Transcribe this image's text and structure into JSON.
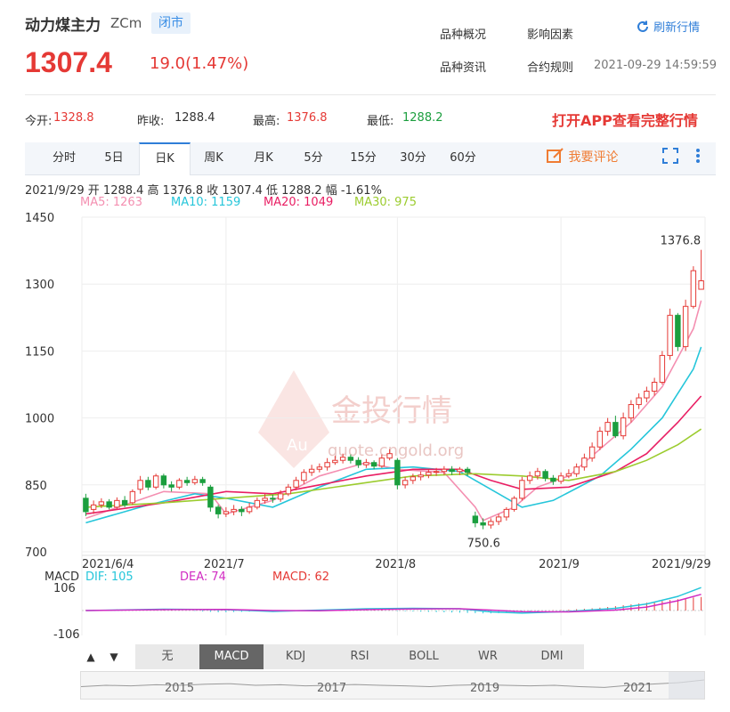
{
  "header": {
    "name": "动力煤主力",
    "code": "ZCm",
    "status": "闭市",
    "price": "1307.4",
    "change": "19.0(1.47%)",
    "links": [
      "品种概况",
      "影响因素",
      "品种资讯",
      "合约规则"
    ],
    "refresh_label": "刷新行情",
    "datetime": "2021-09-29 14:59:59"
  },
  "stats": {
    "open_label": "今开:",
    "open": "1328.8",
    "prev_label": "昨收:",
    "prev": "1288.4",
    "high_label": "最高:",
    "high": "1376.8",
    "low_label": "最低:",
    "low": "1288.2",
    "open_app": "打开APP查看完整行情"
  },
  "tabs": [
    "分时",
    "5日",
    "日K",
    "周K",
    "月K",
    "5分",
    "15分",
    "30分",
    "60分"
  ],
  "active_tab": "日K",
  "comment_label": "我要评论",
  "ohlc_line": "2021/9/29  开 1288.4  高 1376.8  收 1307.4  低 1288.2  幅 -1.61%",
  "ma_labels": [
    {
      "text": "MA5: 1263",
      "color": "#f48fb1"
    },
    {
      "text": "MA10: 1159",
      "color": "#26c6da"
    },
    {
      "text": "MA20: 1049",
      "color": "#e91e63"
    },
    {
      "text": "MA30: 975",
      "color": "#9ccc2f"
    }
  ],
  "watermark": {
    "text": "金投行情",
    "sub": "quote.cngold.org",
    "logo": "Au"
  },
  "macd_header": {
    "label": "MACD",
    "dif": "DIF: 105",
    "dea": "DEA: 74",
    "macd": "MACD: 62"
  },
  "macd_buttons": [
    "无",
    "MACD",
    "KDJ",
    "RSI",
    "BOLL",
    "WR",
    "DMI"
  ],
  "macd_active": "MACD",
  "arrows": [
    "▲",
    "▼"
  ],
  "navigator_years": [
    "2015",
    "2017",
    "2019",
    "2021"
  ],
  "colors": {
    "up": "#e53935",
    "down": "#1b9e3e",
    "accent": "#2f7ed8",
    "orange": "#f07c33"
  },
  "chart_data": {
    "type": "candlestick",
    "ylim": [
      700,
      1450
    ],
    "yticks": [
      1450,
      1300,
      1150,
      1000,
      850,
      700
    ],
    "xticks": [
      "2021/6/4",
      "2021/7",
      "2021/8",
      "2021/9",
      "2021/9/29"
    ],
    "annotations": [
      {
        "text": "1376.8",
        "value": 1376.8
      },
      {
        "text": "750.6",
        "value": 750.6
      }
    ],
    "candles": [
      [
        820,
        790,
        830,
        780
      ],
      [
        795,
        805,
        815,
        785
      ],
      [
        805,
        812,
        820,
        798
      ],
      [
        812,
        800,
        818,
        795
      ],
      [
        800,
        815,
        822,
        796
      ],
      [
        815,
        805,
        825,
        800
      ],
      [
        810,
        835,
        840,
        805
      ],
      [
        840,
        860,
        870,
        830
      ],
      [
        860,
        845,
        868,
        838
      ],
      [
        845,
        870,
        875,
        840
      ],
      [
        870,
        850,
        875,
        842
      ],
      [
        850,
        845,
        858,
        835
      ],
      [
        845,
        860,
        865,
        840
      ],
      [
        860,
        855,
        868,
        848
      ],
      [
        855,
        862,
        870,
        850
      ],
      [
        862,
        855,
        868,
        848
      ],
      [
        845,
        800,
        850,
        790
      ],
      [
        800,
        785,
        805,
        775
      ],
      [
        785,
        790,
        800,
        778
      ],
      [
        790,
        795,
        805,
        782
      ],
      [
        795,
        790,
        802,
        780
      ],
      [
        790,
        800,
        810,
        785
      ],
      [
        800,
        815,
        822,
        795
      ],
      [
        815,
        820,
        830,
        808
      ],
      [
        820,
        818,
        828,
        810
      ],
      [
        818,
        830,
        838,
        812
      ],
      [
        830,
        845,
        852,
        825
      ],
      [
        845,
        860,
        868,
        838
      ],
      [
        860,
        878,
        885,
        852
      ],
      [
        878,
        885,
        895,
        870
      ],
      [
        885,
        890,
        898,
        878
      ],
      [
        890,
        900,
        910,
        882
      ],
      [
        900,
        905,
        915,
        895
      ],
      [
        905,
        912,
        920,
        898
      ],
      [
        912,
        905,
        918,
        898
      ],
      [
        905,
        895,
        912,
        888
      ],
      [
        895,
        900,
        908,
        888
      ],
      [
        900,
        892,
        905,
        885
      ],
      [
        892,
        910,
        918,
        888
      ],
      [
        910,
        920,
        930,
        905
      ],
      [
        905,
        850,
        910,
        840
      ],
      [
        850,
        860,
        868,
        842
      ],
      [
        860,
        868,
        875,
        852
      ],
      [
        868,
        872,
        880,
        860
      ],
      [
        872,
        878,
        885,
        865
      ],
      [
        878,
        880,
        888,
        870
      ],
      [
        880,
        885,
        892,
        872
      ],
      [
        885,
        880,
        892,
        872
      ],
      [
        880,
        885,
        890,
        872
      ],
      [
        885,
        878,
        890,
        870
      ],
      [
        780,
        765,
        790,
        755
      ],
      [
        765,
        760,
        775,
        750.6
      ],
      [
        760,
        768,
        775,
        752
      ],
      [
        768,
        778,
        785,
        760
      ],
      [
        778,
        795,
        800,
        770
      ],
      [
        795,
        820,
        825,
        790
      ],
      [
        820,
        860,
        868,
        815
      ],
      [
        860,
        870,
        880,
        852
      ],
      [
        870,
        880,
        888,
        862
      ],
      [
        880,
        865,
        885,
        858
      ],
      [
        865,
        858,
        872,
        850
      ],
      [
        858,
        870,
        878,
        852
      ],
      [
        870,
        875,
        885,
        865
      ],
      [
        875,
        890,
        898,
        868
      ],
      [
        890,
        910,
        920,
        882
      ],
      [
        910,
        935,
        945,
        902
      ],
      [
        935,
        970,
        980,
        928
      ],
      [
        970,
        990,
        1000,
        960
      ],
      [
        990,
        960,
        1005,
        955
      ],
      [
        960,
        1000,
        1012,
        952
      ],
      [
        1000,
        1030,
        1040,
        990
      ],
      [
        1030,
        1045,
        1055,
        1020
      ],
      [
        1045,
        1060,
        1070,
        1035
      ],
      [
        1060,
        1080,
        1090,
        1050
      ],
      [
        1080,
        1140,
        1150,
        1075
      ],
      [
        1140,
        1230,
        1245,
        1130
      ],
      [
        1230,
        1160,
        1235,
        1150
      ],
      [
        1160,
        1250,
        1265,
        1150
      ],
      [
        1250,
        1330,
        1340,
        1245
      ],
      [
        1288.4,
        1307.4,
        1376.8,
        1288.2
      ]
    ],
    "ma": [
      {
        "name": "MA5",
        "color": "#f48fb1",
        "values": [
          [
            0,
            775
          ],
          [
            10,
            835
          ],
          [
            16,
            830
          ],
          [
            18,
            785
          ],
          [
            24,
            815
          ],
          [
            30,
            870
          ],
          [
            36,
            900
          ],
          [
            40,
            885
          ],
          [
            46,
            878
          ],
          [
            50,
            800
          ],
          [
            51,
            770
          ],
          [
            55,
            800
          ],
          [
            58,
            845
          ],
          [
            62,
            870
          ],
          [
            66,
            930
          ],
          [
            70,
            990
          ],
          [
            74,
            1070
          ],
          [
            78,
            1200
          ],
          [
            79,
            1263
          ]
        ]
      },
      {
        "name": "MA10",
        "color": "#26c6da",
        "values": [
          [
            0,
            765
          ],
          [
            8,
            805
          ],
          [
            14,
            830
          ],
          [
            18,
            820
          ],
          [
            24,
            800
          ],
          [
            30,
            845
          ],
          [
            36,
            885
          ],
          [
            42,
            890
          ],
          [
            48,
            880
          ],
          [
            52,
            840
          ],
          [
            56,
            800
          ],
          [
            60,
            815
          ],
          [
            66,
            870
          ],
          [
            70,
            930
          ],
          [
            74,
            1000
          ],
          [
            78,
            1110
          ],
          [
            79,
            1159
          ]
        ]
      },
      {
        "name": "MA20",
        "color": "#e91e63",
        "values": [
          [
            0,
            785
          ],
          [
            10,
            810
          ],
          [
            18,
            835
          ],
          [
            24,
            830
          ],
          [
            30,
            850
          ],
          [
            36,
            870
          ],
          [
            42,
            885
          ],
          [
            48,
            885
          ],
          [
            52,
            860
          ],
          [
            56,
            840
          ],
          [
            62,
            845
          ],
          [
            68,
            880
          ],
          [
            72,
            920
          ],
          [
            76,
            990
          ],
          [
            79,
            1049
          ]
        ]
      },
      {
        "name": "MA30",
        "color": "#9ccc2f",
        "values": [
          [
            0,
            800
          ],
          [
            10,
            810
          ],
          [
            18,
            820
          ],
          [
            26,
            830
          ],
          [
            34,
            850
          ],
          [
            42,
            870
          ],
          [
            50,
            875
          ],
          [
            56,
            870
          ],
          [
            62,
            860
          ],
          [
            68,
            880
          ],
          [
            72,
            905
          ],
          [
            76,
            940
          ],
          [
            79,
            975
          ]
        ]
      }
    ],
    "macd": {
      "ylim": [
        -106,
        106
      ],
      "yticks": [
        106,
        -106
      ],
      "dif": [
        [
          0,
          0
        ],
        [
          10,
          6
        ],
        [
          18,
          4
        ],
        [
          24,
          -4
        ],
        [
          30,
          2
        ],
        [
          36,
          8
        ],
        [
          42,
          10
        ],
        [
          48,
          8
        ],
        [
          52,
          -6
        ],
        [
          56,
          -12
        ],
        [
          62,
          -4
        ],
        [
          68,
          10
        ],
        [
          72,
          30
        ],
        [
          76,
          65
        ],
        [
          79,
          105
        ]
      ],
      "dea": [
        [
          0,
          0
        ],
        [
          10,
          4
        ],
        [
          18,
          5
        ],
        [
          24,
          0
        ],
        [
          30,
          -1
        ],
        [
          36,
          4
        ],
        [
          42,
          7
        ],
        [
          48,
          8
        ],
        [
          52,
          2
        ],
        [
          56,
          -5
        ],
        [
          62,
          -6
        ],
        [
          68,
          2
        ],
        [
          72,
          16
        ],
        [
          76,
          45
        ],
        [
          79,
          74
        ]
      ],
      "hist": [
        2,
        3,
        4,
        4,
        5,
        5,
        6,
        6,
        5,
        4,
        3,
        2,
        1,
        0,
        -2,
        -4,
        -6,
        -8,
        -8,
        -7,
        -6,
        -5,
        -4,
        -3,
        -2,
        -1,
        0,
        1,
        2,
        3,
        4,
        4,
        5,
        5,
        4,
        3,
        3,
        2,
        2,
        1,
        -2,
        -3,
        -4,
        -5,
        -6,
        -7,
        -8,
        -9,
        -10,
        -11,
        -12,
        -13,
        -13,
        -12,
        -11,
        -9,
        -7,
        -5,
        -3,
        -1,
        1,
        2,
        4,
        6,
        8,
        10,
        13,
        16,
        20,
        24,
        28,
        32,
        36,
        40,
        44,
        48,
        52,
        56,
        60,
        62
      ]
    },
    "navigator": [
      0.55,
      0.5,
      0.52,
      0.48,
      0.5,
      0.46,
      0.44,
      0.5,
      0.48,
      0.52,
      0.5,
      0.47,
      0.5,
      0.52,
      0.55,
      0.5,
      0.48,
      0.5,
      0.52,
      0.5,
      0.55,
      0.58,
      0.5,
      0.45,
      0.4,
      0.3
    ]
  }
}
